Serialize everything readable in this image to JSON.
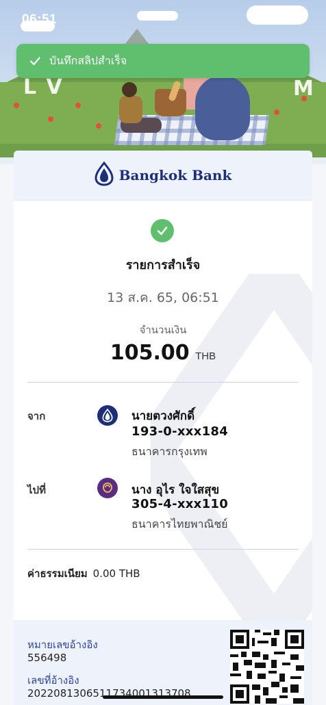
{
  "status_bar": {
    "time": "06:51"
  },
  "banner": {
    "letters_left": "L V",
    "letters_right": "M"
  },
  "toast": {
    "message": "บันทึกสลิปสำเร็จ",
    "color": "#5fbf6e"
  },
  "bank": {
    "name": "Bangkok Bank",
    "brand_color": "#1e2f7a"
  },
  "transaction": {
    "status": "รายการสำเร็จ",
    "datetime": "13 ส.ค. 65, 06:51",
    "amount_label": "จำนวนเงิน",
    "amount": "105.00",
    "currency": "THB"
  },
  "from": {
    "label": "จาก",
    "name": "นายตวงศักดิ์",
    "account": "193-0-xxx184",
    "bank": "ธนาคารกรุงเทพ",
    "icon": "bangkok-bank-logo-icon",
    "icon_color": "#1e2f7a"
  },
  "to": {
    "label": "ไปที่",
    "name": "นาง อุไร ใจใสสุข",
    "account": "305-4-xxx110",
    "bank": "ธนาคารไทยพาณิชย์",
    "icon": "scb-logo-icon",
    "icon_color": "#5b2c83"
  },
  "fee": {
    "label": "ค่าธรรมเนียม",
    "value": "0.00 THB"
  },
  "reference": {
    "memo_label": "หมายเลขอ้างอิง",
    "memo_value": "556498",
    "ref_label": "เลขที่อ้างอิง",
    "ref_value": "20220813065117340013137​08"
  }
}
